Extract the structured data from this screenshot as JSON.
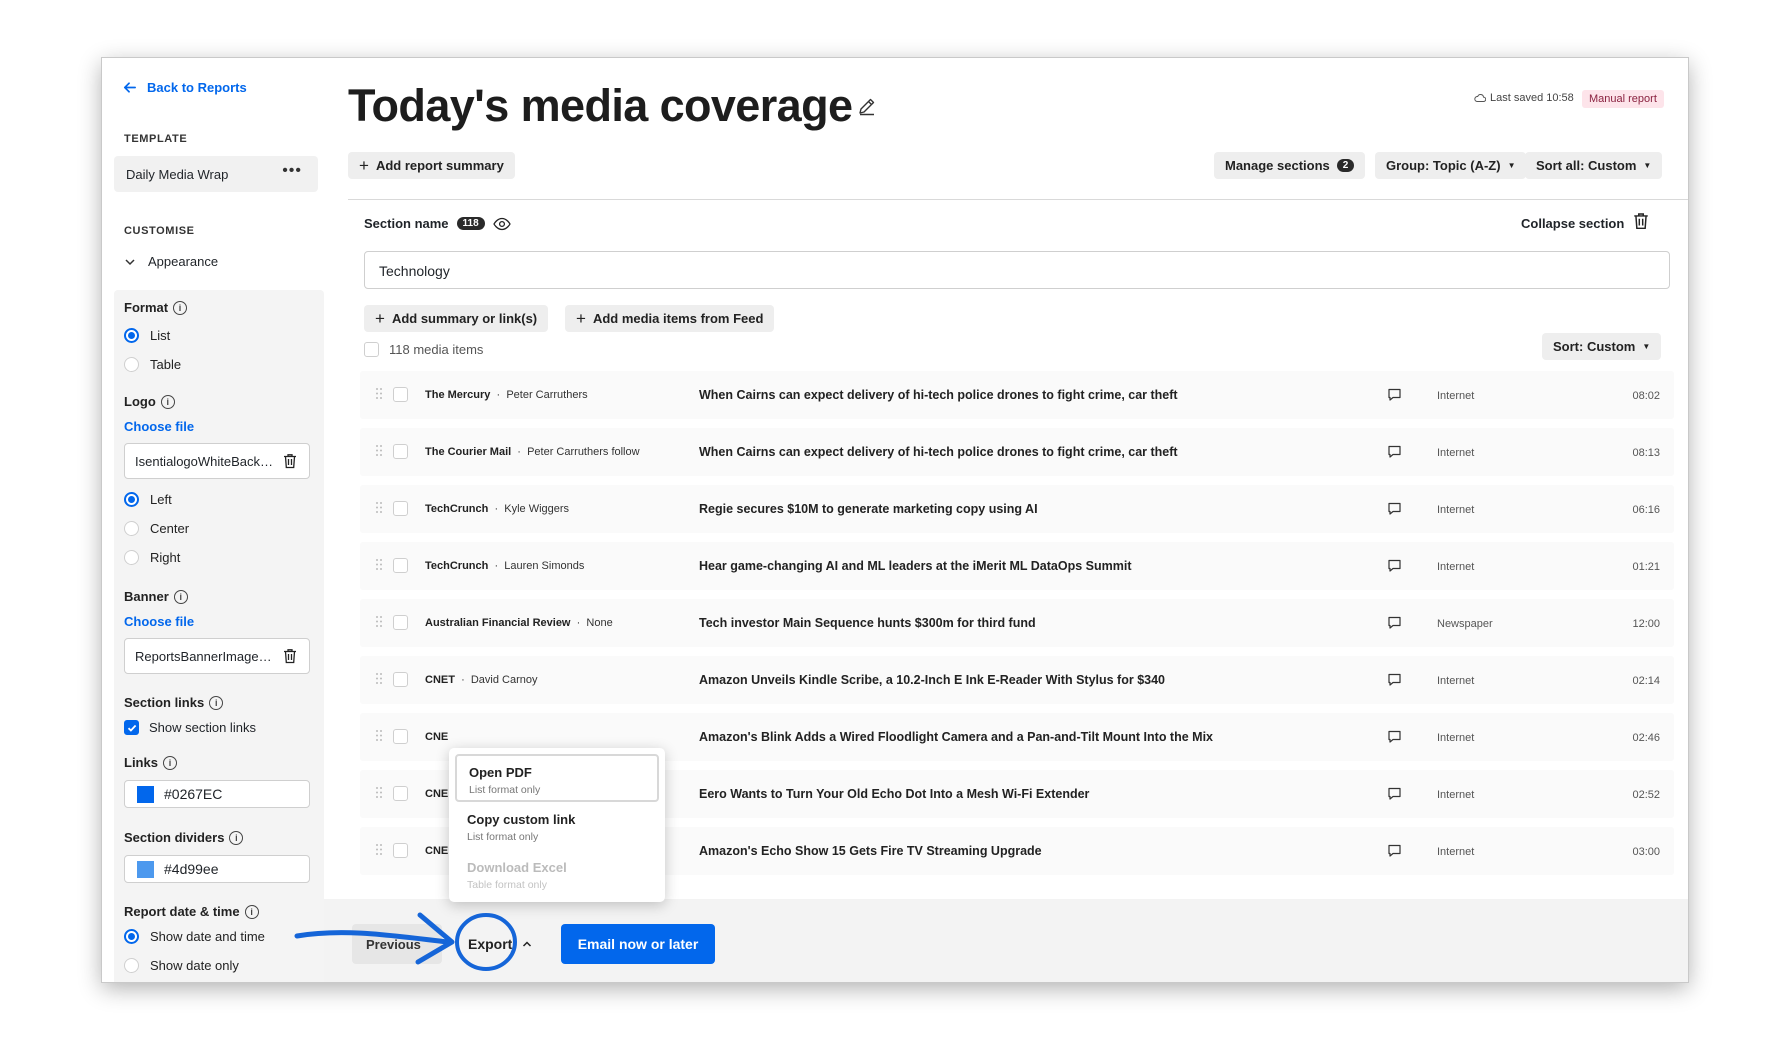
{
  "nav": {
    "back_label": "Back to Reports"
  },
  "sidebar": {
    "template_label": "TEMPLATE",
    "template_value": "Daily Media Wrap",
    "template_menu": "•••",
    "customise_label": "CUSTOMISE",
    "appearance_label": "Appearance",
    "format": {
      "label": "Format",
      "options": [
        "List",
        "Table"
      ],
      "selected": "List"
    },
    "logo": {
      "label": "Logo",
      "choose_file": "Choose file",
      "file_name": "IsentialogoWhiteBackground.png",
      "alignment": [
        "Left",
        "Center",
        "Right"
      ],
      "selected": "Left"
    },
    "banner": {
      "label": "Banner",
      "choose_file": "Choose file",
      "file_name": "ReportsBannerImage.png"
    },
    "section_links": {
      "label": "Section links",
      "checkbox_label": "Show section links",
      "checked": true
    },
    "links": {
      "label": "Links",
      "color": "#0267EC"
    },
    "section_dividers": {
      "label": "Section dividers",
      "color": "#4d99ee"
    },
    "report_date": {
      "label": "Report date & time",
      "options": [
        "Show date and time",
        "Show date only"
      ],
      "selected": "Show date and time"
    }
  },
  "header": {
    "title": "Today's media coverage",
    "last_saved": "Last saved 10:58",
    "badge": "Manual report"
  },
  "toolbar": {
    "add_summary": "Add report summary",
    "manage_sections": "Manage sections",
    "manage_sections_count": "2",
    "group": "Group: Topic (A-Z)",
    "sort_all": "Sort all: Custom"
  },
  "section": {
    "name_label": "Section name",
    "count": "118",
    "collapse_label": "Collapse section",
    "name_value": "Technology",
    "add_summary_links": "Add summary or link(s)",
    "add_media_items": "Add media items from Feed",
    "media_items_label": "118 media items",
    "sort_label": "Sort: Custom"
  },
  "rows": [
    {
      "outlet": "The Mercury",
      "author": "Peter Carruthers",
      "headline": "When Cairns can expect delivery of hi-tech police drones to fight crime, car theft",
      "media": "Internet",
      "time": "08:02"
    },
    {
      "outlet": "The Courier Mail",
      "author": "Peter Carruthers follow",
      "headline": "When Cairns can expect delivery of hi-tech police drones to fight crime, car theft",
      "media": "Internet",
      "time": "08:13"
    },
    {
      "outlet": "TechCrunch",
      "author": "Kyle Wiggers",
      "headline": "Regie secures $10M to generate marketing copy using AI",
      "media": "Internet",
      "time": "06:16"
    },
    {
      "outlet": "TechCrunch",
      "author": "Lauren Simonds",
      "headline": "Hear game-changing AI and ML leaders at the iMerit ML DataOps Summit",
      "media": "Internet",
      "time": "01:21"
    },
    {
      "outlet": "Australian Financial Review",
      "author": "None",
      "headline": "Tech investor Main Sequence hunts $300m for third fund",
      "media": "Newspaper",
      "time": "12:00"
    },
    {
      "outlet": "CNET",
      "author": "David Carnoy",
      "headline": "Amazon Unveils Kindle Scribe, a 10.2-Inch E Ink E-Reader With Stylus for $340",
      "media": "Internet",
      "time": "02:14"
    },
    {
      "outlet": "CNE",
      "author": "",
      "headline": "Amazon's Blink Adds a Wired Floodlight Camera and a Pan-and-Tilt Mount Into the Mix",
      "media": "Internet",
      "time": "02:46"
    },
    {
      "outlet": "CNE",
      "author": "",
      "headline": "Eero Wants to Turn Your Old Echo Dot Into a Mesh Wi-Fi Extender",
      "media": "Internet",
      "time": "02:52"
    },
    {
      "outlet": "CNE",
      "author": "",
      "headline": "Amazon's Echo Show 15 Gets Fire TV Streaming Upgrade",
      "media": "Internet",
      "time": "03:00"
    }
  ],
  "export_menu": [
    {
      "label": "Open PDF",
      "sub": "List format only",
      "state": "active"
    },
    {
      "label": "Copy custom link",
      "sub": "List format only",
      "state": "normal"
    },
    {
      "label": "Download Excel",
      "sub": "Table format only",
      "state": "disabled"
    }
  ],
  "footer": {
    "previous_label": "Previous",
    "export_label": "Export",
    "email_label": "Email now or later"
  },
  "colors": {
    "accent": "#0267ec",
    "annotation": "#1565d8"
  }
}
